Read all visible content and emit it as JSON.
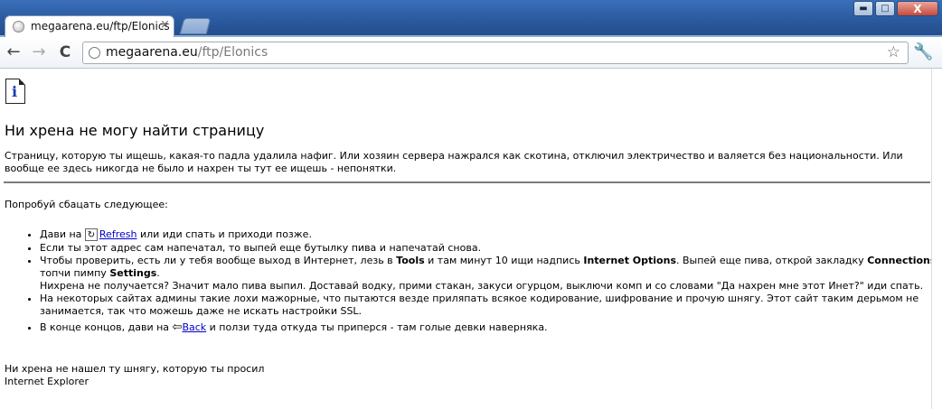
{
  "tab": {
    "title": "megaarena.eu/ftp/Elonics",
    "close": "×"
  },
  "window": {
    "minimize": "▬",
    "maximize": "□",
    "close": "X"
  },
  "toolbar": {
    "back": "←",
    "forward": "→",
    "reload": "C",
    "url_host": "megaarena.eu",
    "url_path": "/ftp/Elonics",
    "star": "☆",
    "wrench": "🔧"
  },
  "page": {
    "icon_letter": "i",
    "heading": "Ни хрена не могу найти страницу",
    "intro": "Страницу, которую ты ищешь, какая-то падла удалила нафиг. Или хозяин сервера нажрался как скотина, отключил электричество и валяется без национальности. Или вообще ее здесь никогда не было и нахрен ты тут ее ищешь - непонятки.",
    "try_label": "Попробуй сбацать следующее:",
    "items": [
      {
        "before": "Дави на ",
        "link": "Refresh",
        "after": " или иди спать и приходи позже."
      },
      {
        "text": "Если ты этот адрес сам напечатал, то выпей еще бутылку пива и напечатай снова."
      },
      {
        "a": "Чтобы проверить, есть ли у тебя вообще выход в Интернет, лезь в ",
        "b": "Tools",
        "c": " и там минут 10 ищи надпись ",
        "d": "Internet Options",
        "e": ". Выпей еще пива, открой закладку ",
        "f": "Connections",
        "g": ", топчи пимпу ",
        "h": "Settings",
        "i": ".",
        "line2": "Нихрена не получается? Значит мало пива выпил. Доставай водку, прими стакан, закуси огурцом, выключи комп и со словами \"Да нахрен мне этот Инет?\" иди спать."
      },
      {
        "text": "На некоторых сайтах админы такие лохи мажорные, что пытаются везде приляпать всякое кодирование, шифрование и прочую шнягу. Этот сайт таким дерьмом не занимается, так что можешь даже не искать настройки SSL."
      },
      {
        "before": "В конце концов, дави на ",
        "link": "Back",
        "after": " и ползи туда откуда ты приперся - там голые девки наверняка."
      }
    ],
    "footer_line1": "Ни хрена не нашел ту шнягу, которую ты просил",
    "footer_line2": "Internet Explorer"
  }
}
